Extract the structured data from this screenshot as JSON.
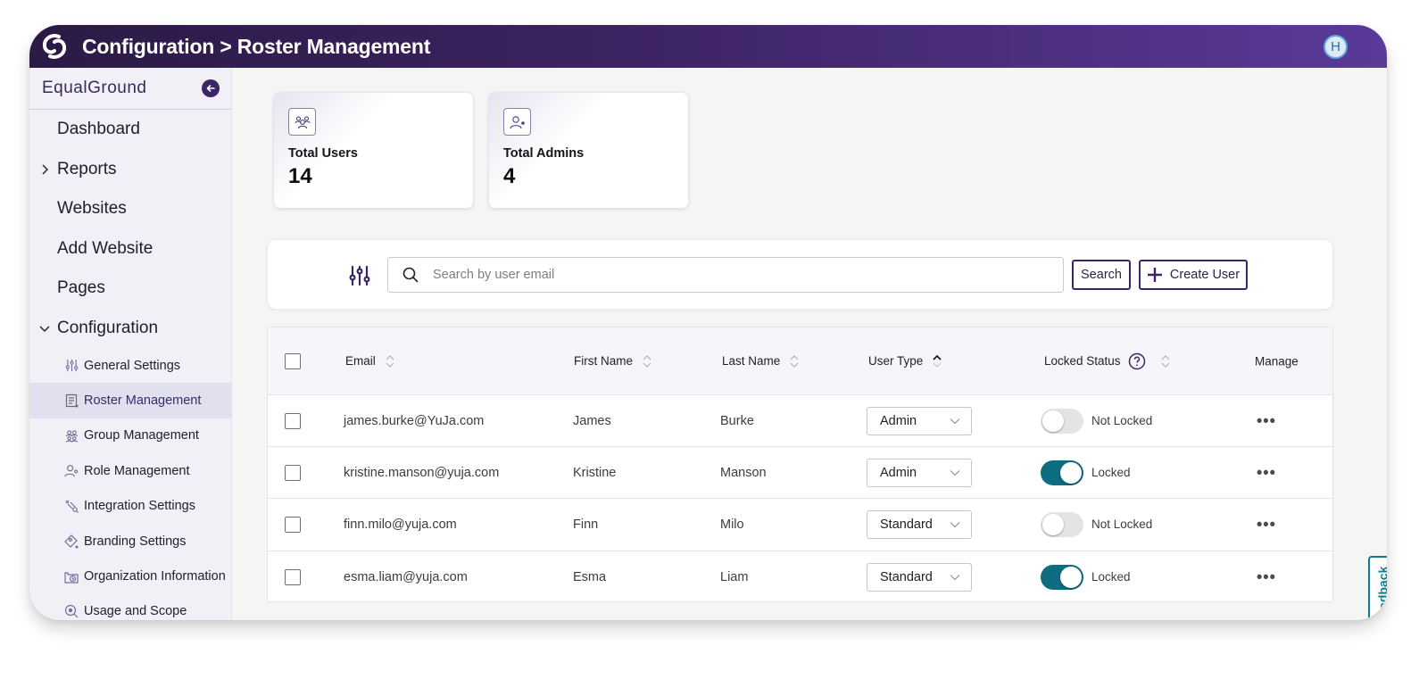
{
  "header": {
    "title": "Configuration > Roster Management",
    "logo_icon": "yuja-logo-icon",
    "avatar_initial": "H"
  },
  "sidebar": {
    "brand": "EqualGround",
    "collapse_icon": "arrow-left-circle-icon",
    "items": [
      {
        "label": "Dashboard",
        "chevron": "none"
      },
      {
        "label": "Reports",
        "chevron": "right"
      },
      {
        "label": "Websites",
        "chevron": "none"
      },
      {
        "label": "Add Website",
        "chevron": "none"
      },
      {
        "label": "Pages",
        "chevron": "none"
      },
      {
        "label": "Configuration",
        "chevron": "down"
      }
    ],
    "sub_items": [
      {
        "label": "General Settings",
        "icon": "sliders-icon",
        "active": false
      },
      {
        "label": "Roster Management",
        "icon": "roster-list-icon",
        "active": true
      },
      {
        "label": "Group Management",
        "icon": "group-icon",
        "active": false
      },
      {
        "label": "Role Management",
        "icon": "user-gear-icon",
        "active": false
      },
      {
        "label": "Integration Settings",
        "icon": "plug-icon",
        "active": false
      },
      {
        "label": "Branding Settings",
        "icon": "tag-icon",
        "active": false
      },
      {
        "label": "Organization Information",
        "icon": "building-icon",
        "active": false
      },
      {
        "label": "Usage and Scope",
        "icon": "magnify-target-icon",
        "active": false
      }
    ]
  },
  "stats": [
    {
      "label": "Total Users",
      "value": "14",
      "icon": "users-icon"
    },
    {
      "label": "Total Admins",
      "value": "4",
      "icon": "admin-user-icon"
    }
  ],
  "search": {
    "placeholder": "Search by user email",
    "value": "",
    "search_label": "Search",
    "create_label": "Create User"
  },
  "table": {
    "columns": [
      {
        "label": "Email",
        "sort": "none"
      },
      {
        "label": "First Name",
        "sort": "none"
      },
      {
        "label": "Last Name",
        "sort": "none"
      },
      {
        "label": "User Type",
        "sort": "asc"
      },
      {
        "label": "Locked Status",
        "sort": "none"
      },
      {
        "label": "Manage",
        "sort": null
      }
    ],
    "rows": [
      {
        "email": "james.burke@YuJa.com",
        "first": "James",
        "last": "Burke",
        "type": "Admin",
        "locked": false,
        "locked_label": "Not Locked"
      },
      {
        "email": "kristine.manson@yuja.com",
        "first": "Kristine",
        "last": "Manson",
        "type": "Admin",
        "locked": true,
        "locked_label": "Locked"
      },
      {
        "email": "finn.milo@yuja.com",
        "first": "Finn",
        "last": "Milo",
        "type": "Standard",
        "locked": false,
        "locked_label": "Not Locked"
      },
      {
        "email": "esma.liam@yuja.com",
        "first": "Esma",
        "last": "Liam",
        "type": "Standard",
        "locked": true,
        "locked_label": "Locked"
      }
    ],
    "manage_label": "•••"
  },
  "feedback_label": "Feedback",
  "colors": {
    "header_start": "#2b1a45",
    "header_end": "#5a3a9a",
    "accent": "#3b2566",
    "toggle_on": "#0e6c80",
    "feedback": "#147a8e"
  }
}
